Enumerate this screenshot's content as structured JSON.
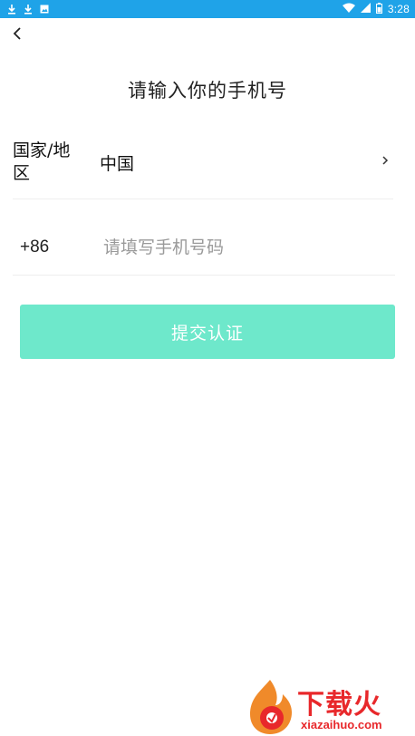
{
  "status_bar": {
    "time": "3:28",
    "left_icons": [
      "download-icon",
      "download-icon",
      "image-notification-icon"
    ],
    "right_icons": [
      "wifi-icon",
      "signal-icon",
      "battery-icon"
    ],
    "background": "#1fa3e8"
  },
  "header": {
    "back_icon": "chevron-left-icon",
    "title": "请输入你的手机号"
  },
  "country": {
    "label": "国家/地区",
    "value": "中国",
    "chevron_icon": "chevron-right-icon"
  },
  "phone": {
    "dial_code": "+86",
    "value": "",
    "placeholder": "请填写手机号码"
  },
  "submit": {
    "label": "提交认证",
    "color": "#6ee8cb"
  },
  "watermark": {
    "text": "下载火",
    "domain": "xiazaihuo.com",
    "color": "#e8282b"
  }
}
